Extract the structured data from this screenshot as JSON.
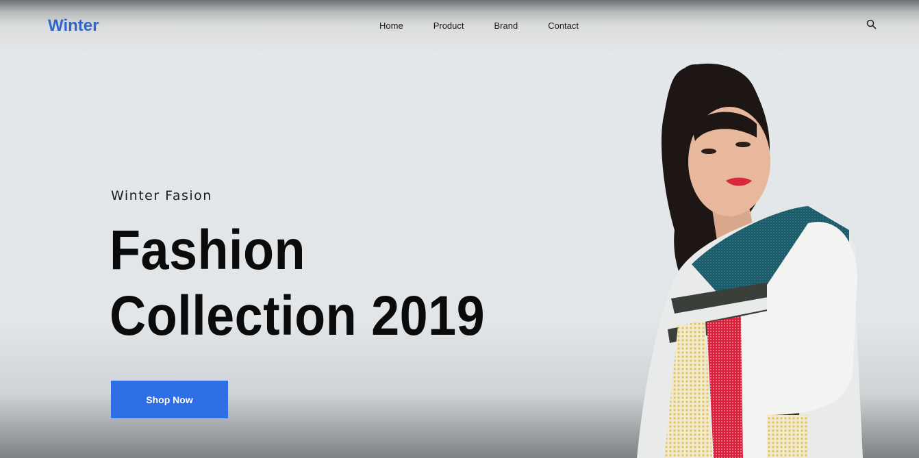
{
  "brand": {
    "name": "Winter",
    "color": "#2f66c9"
  },
  "nav": {
    "items": [
      {
        "label": "Home"
      },
      {
        "label": "Product"
      },
      {
        "label": "Brand"
      },
      {
        "label": "Contact"
      }
    ],
    "search_icon": "search-icon"
  },
  "hero": {
    "eyebrow": "Winter Fasion",
    "headline_line1": "Fashion",
    "headline_line2": "Collection 2019",
    "cta_label": "Shop Now",
    "cta_color": "#2e6fe6",
    "image": "fashion-model-photo"
  }
}
